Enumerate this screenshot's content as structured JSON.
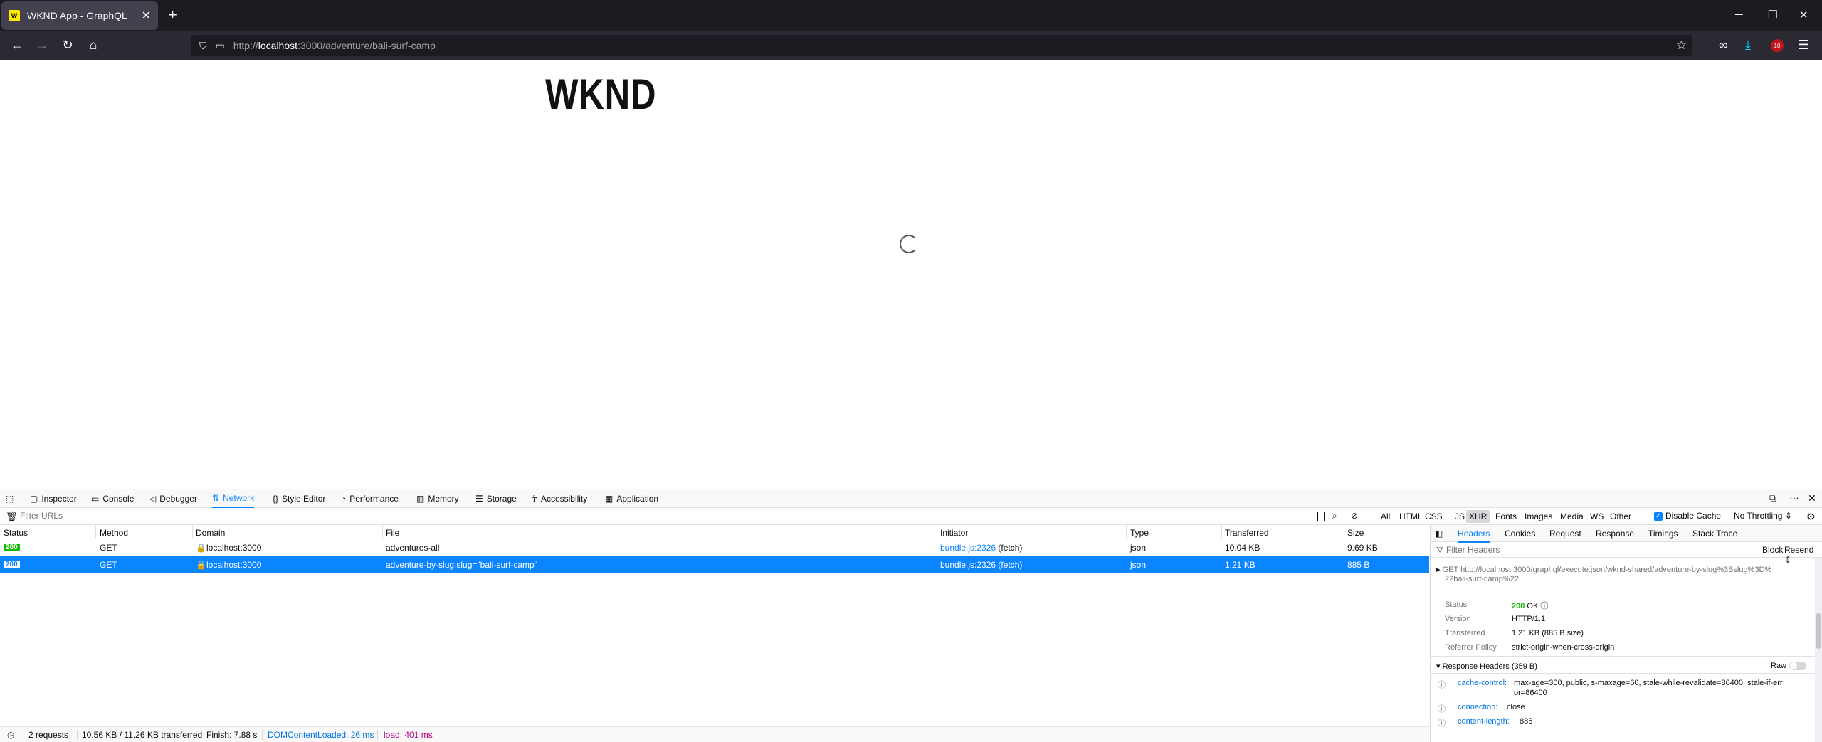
{
  "browser": {
    "tab_title": "WKND App - GraphQL",
    "favicon_text": "W",
    "url_prefix": "http://",
    "url_host": "localhost",
    "url_rest": ":3000/adventure/bali-surf-camp",
    "ublock_badge": "10"
  },
  "page": {
    "logo": "WKND"
  },
  "devtools": {
    "tabs": [
      {
        "label": "Inspector",
        "icon": "inspector-icon"
      },
      {
        "label": "Console",
        "icon": "console-icon"
      },
      {
        "label": "Debugger",
        "icon": "debugger-icon"
      },
      {
        "label": "Network",
        "icon": "network-icon"
      },
      {
        "label": "Style Editor",
        "icon": "style-editor-icon"
      },
      {
        "label": "Performance",
        "icon": "performance-icon"
      },
      {
        "label": "Memory",
        "icon": "memory-icon"
      },
      {
        "label": "Storage",
        "icon": "storage-icon"
      },
      {
        "label": "Accessibility",
        "icon": "accessibility-icon"
      },
      {
        "label": "Application",
        "icon": "application-icon"
      }
    ],
    "active_tab": "Network",
    "filter_placeholder": "Filter URLs",
    "type_filters": [
      "All",
      "HTML",
      "CSS",
      "JS",
      "XHR",
      "Fonts",
      "Images",
      "Media",
      "WS",
      "Other"
    ],
    "active_type": "XHR",
    "disable_cache_label": "Disable Cache",
    "throttling": "No Throttling",
    "columns": [
      "Status",
      "Method",
      "Domain",
      "File",
      "Initiator",
      "Type",
      "Transferred",
      "Size"
    ],
    "requests": [
      {
        "status": "200",
        "method": "GET",
        "domain": "localhost:3000",
        "file": "adventures-all",
        "initiator_file": "bundle.js",
        "initiator_line": ":2326",
        "initiator_suffix": " (fetch)",
        "type": "json",
        "transferred": "10.04 KB",
        "size": "9.69 KB"
      },
      {
        "status": "200",
        "method": "GET",
        "domain": "localhost:3000",
        "file": "adventure-by-slug;slug=\"bali-surf-camp\"",
        "initiator_file": "bundle.js",
        "initiator_line": ":2326",
        "initiator_suffix": " (fetch)",
        "type": "json",
        "transferred": "1.21 KB",
        "size": "885 B"
      }
    ],
    "selected_row": 1,
    "statusbar": {
      "requests": "2 requests",
      "transferred": "10.56 KB / 11.26 KB transferred",
      "finish": "Finish: 7.88 s",
      "dom_loaded": "DOMContentLoaded: 26 ms",
      "load": "load: 401 ms"
    },
    "details": {
      "tabs": [
        "Headers",
        "Cookies",
        "Request",
        "Response",
        "Timings",
        "Stack Trace"
      ],
      "active": "Headers",
      "filter_placeholder": "Filter Headers",
      "block_label": "Block",
      "resend_label": "Resend",
      "request_method": "GET",
      "request_url_line1": "http://localhost:3000/graphql/execute.json/wknd-shared/adventure-by-slug%3Bslug%3D%",
      "request_url_line2": "22bali-surf-camp%22",
      "summary": [
        {
          "label": "Status",
          "value": "200",
          "extra": "OK"
        },
        {
          "label": "Version",
          "value": "HTTP/1.1"
        },
        {
          "label": "Transferred",
          "value": "1.21 KB (885 B size)"
        },
        {
          "label": "Referrer Policy",
          "value": "strict-origin-when-cross-origin"
        }
      ],
      "response_headers_title": "Response Headers (359 B)",
      "raw_label": "Raw",
      "headers": [
        {
          "name": "cache-control:",
          "value_line1": "max-age=300, public, s-maxage=60, stale-while-revalidate=86400, stale-if-err",
          "value_line2": "or=86400"
        },
        {
          "name": "connection:",
          "value_line1": "close",
          "value_line2": ""
        },
        {
          "name": "content-length:",
          "value_line1": "885",
          "value_line2": ""
        }
      ]
    }
  }
}
